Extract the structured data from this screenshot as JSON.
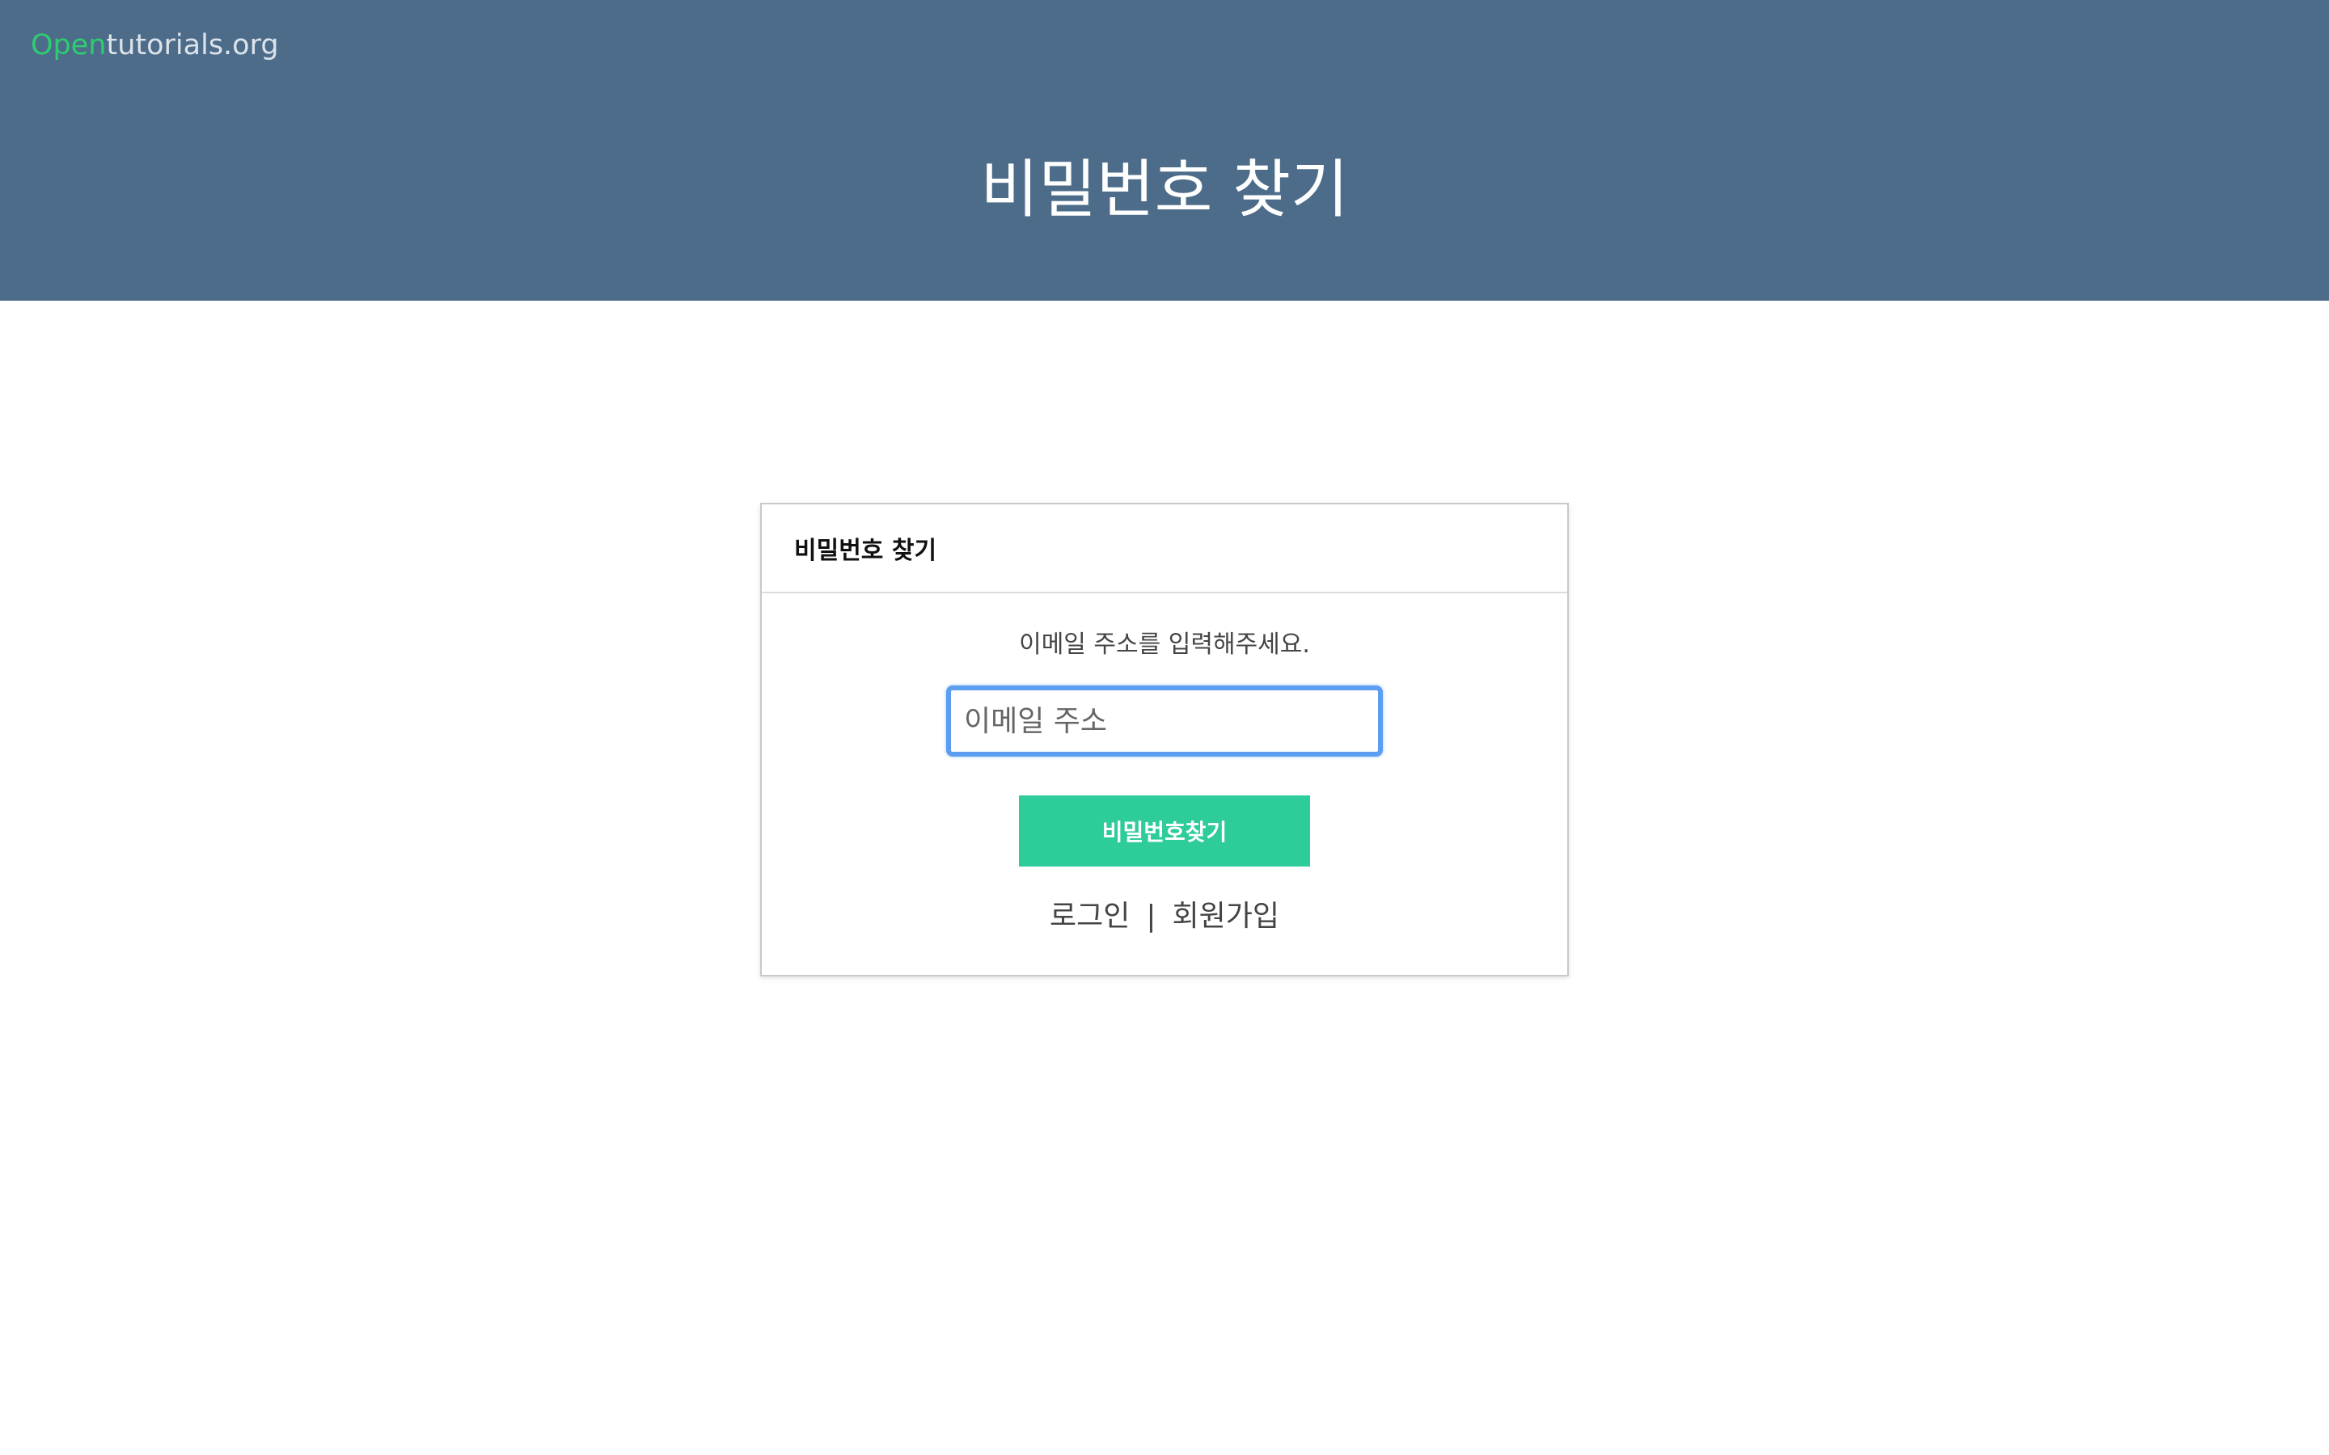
{
  "header": {
    "brand_accent": "Open",
    "brand_rest": "tutorials.org",
    "title": "비밀번호 찾기"
  },
  "card": {
    "title": "비밀번호 찾기",
    "instruction": "이메일 주소를 입력해주세요.",
    "email_placeholder": "이메일 주소",
    "email_value": "",
    "submit_label": "비밀번호찾기",
    "links": {
      "login": "로그인",
      "separator": "|",
      "signup": "회원가입"
    }
  },
  "colors": {
    "header_bg": "#4c6c8a",
    "brand_accent": "#2ecc71",
    "button_bg": "#2ecc9a",
    "input_focus_border": "#5b9ef0"
  }
}
